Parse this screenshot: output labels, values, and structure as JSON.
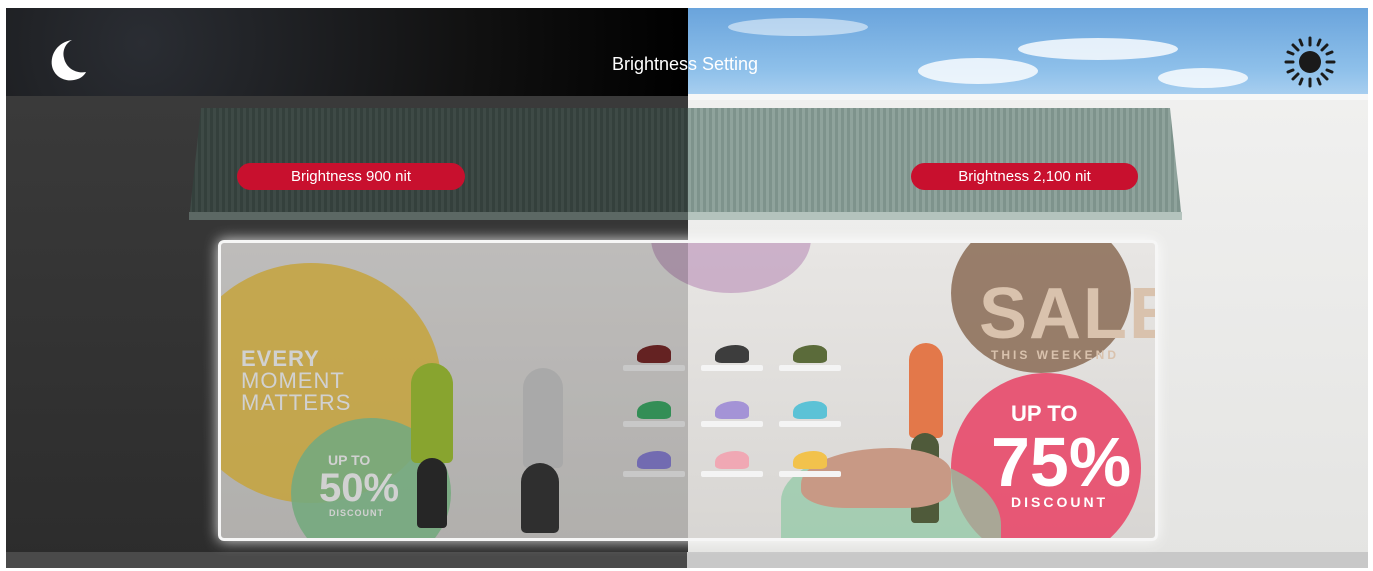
{
  "header": {
    "title": "Brightness Setting",
    "night_icon": "moon-icon",
    "day_icon": "sun-icon"
  },
  "badges": {
    "left": "Brightness 900 nit",
    "right": "Brightness 2,100 nit"
  },
  "display_ad": {
    "left_panel": {
      "line1": "EVERY",
      "line2": "MOMENT",
      "line3": "MATTERS",
      "promo_upto": "UP TO",
      "promo_value": "50%",
      "promo_label": "DISCOUNT"
    },
    "right_panel": {
      "sale": "SALE",
      "sale_sub": "THIS WEEKEND",
      "promo_upto": "UP TO",
      "promo_value": "75%",
      "promo_label": "DISCOUNT"
    }
  },
  "colors": {
    "badge": "#c8102e",
    "night_sky": "#000000",
    "day_sky": "#8ec0ea"
  }
}
